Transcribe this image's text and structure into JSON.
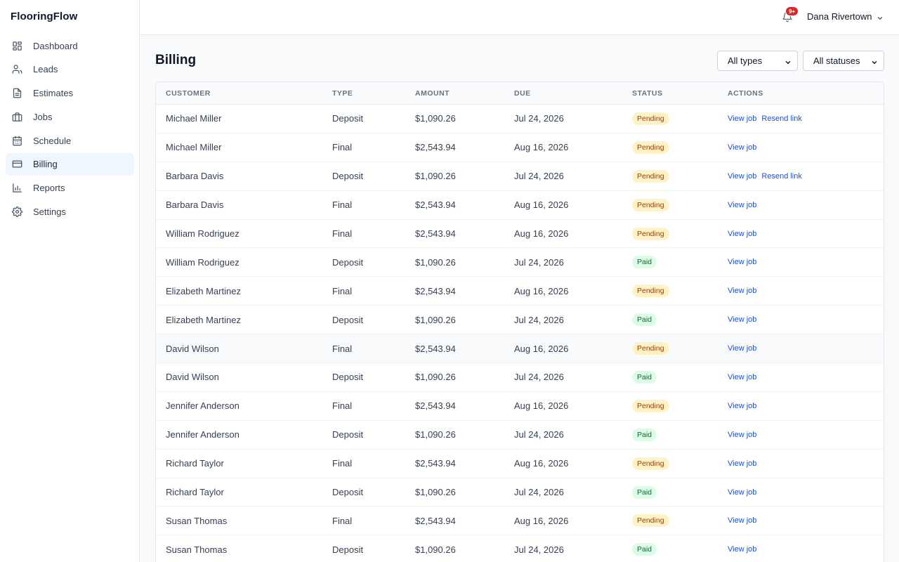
{
  "app": {
    "name": "FlooringFlow"
  },
  "sidebar": {
    "items": [
      {
        "label": "Dashboard",
        "icon": "dashboard-icon"
      },
      {
        "label": "Leads",
        "icon": "users-icon"
      },
      {
        "label": "Estimates",
        "icon": "document-icon"
      },
      {
        "label": "Jobs",
        "icon": "briefcase-icon"
      },
      {
        "label": "Schedule",
        "icon": "calendar-icon"
      },
      {
        "label": "Billing",
        "icon": "credit-card-icon",
        "active": true
      },
      {
        "label": "Reports",
        "icon": "bar-chart-icon"
      },
      {
        "label": "Settings",
        "icon": "gear-icon"
      }
    ]
  },
  "header": {
    "notifications_badge": "9+",
    "user_name": "Dana Rivertown"
  },
  "main": {
    "title": "Billing",
    "filters": {
      "type_selected": "All types",
      "status_selected": "All statuses"
    }
  },
  "table": {
    "columns": [
      "Customer",
      "Type",
      "Amount",
      "Due",
      "Status",
      "Actions"
    ],
    "rows": [
      {
        "customer": "Michael Miller",
        "type": "Deposit",
        "amount": "$1,090.26",
        "due": "Jul 24, 2026",
        "status": "Pending",
        "actions": [
          "View job",
          "Resend link"
        ]
      },
      {
        "customer": "Michael Miller",
        "type": "Final",
        "amount": "$2,543.94",
        "due": "Aug 16, 2026",
        "status": "Pending",
        "actions": [
          "View job"
        ]
      },
      {
        "customer": "Barbara Davis",
        "type": "Deposit",
        "amount": "$1,090.26",
        "due": "Jul 24, 2026",
        "status": "Pending",
        "actions": [
          "View job",
          "Resend link"
        ]
      },
      {
        "customer": "Barbara Davis",
        "type": "Final",
        "amount": "$2,543.94",
        "due": "Aug 16, 2026",
        "status": "Pending",
        "actions": [
          "View job"
        ]
      },
      {
        "customer": "William Rodriguez",
        "type": "Final",
        "amount": "$2,543.94",
        "due": "Aug 16, 2026",
        "status": "Pending",
        "actions": [
          "View job"
        ]
      },
      {
        "customer": "William Rodriguez",
        "type": "Deposit",
        "amount": "$1,090.26",
        "due": "Jul 24, 2026",
        "status": "Paid",
        "actions": [
          "View job"
        ]
      },
      {
        "customer": "Elizabeth Martinez",
        "type": "Final",
        "amount": "$2,543.94",
        "due": "Aug 16, 2026",
        "status": "Pending",
        "actions": [
          "View job"
        ]
      },
      {
        "customer": "Elizabeth Martinez",
        "type": "Deposit",
        "amount": "$1,090.26",
        "due": "Jul 24, 2026",
        "status": "Paid",
        "actions": [
          "View job"
        ]
      },
      {
        "customer": "David Wilson",
        "type": "Final",
        "amount": "$2,543.94",
        "due": "Aug 16, 2026",
        "status": "Pending",
        "actions": [
          "View job"
        ]
      },
      {
        "customer": "David Wilson",
        "type": "Deposit",
        "amount": "$1,090.26",
        "due": "Jul 24, 2026",
        "status": "Paid",
        "actions": [
          "View job"
        ]
      },
      {
        "customer": "Jennifer Anderson",
        "type": "Final",
        "amount": "$2,543.94",
        "due": "Aug 16, 2026",
        "status": "Pending",
        "actions": [
          "View job"
        ]
      },
      {
        "customer": "Jennifer Anderson",
        "type": "Deposit",
        "amount": "$1,090.26",
        "due": "Jul 24, 2026",
        "status": "Paid",
        "actions": [
          "View job"
        ]
      },
      {
        "customer": "Richard Taylor",
        "type": "Final",
        "amount": "$2,543.94",
        "due": "Aug 16, 2026",
        "status": "Pending",
        "actions": [
          "View job"
        ]
      },
      {
        "customer": "Richard Taylor",
        "type": "Deposit",
        "amount": "$1,090.26",
        "due": "Jul 24, 2026",
        "status": "Paid",
        "actions": [
          "View job"
        ]
      },
      {
        "customer": "Susan Thomas",
        "type": "Final",
        "amount": "$2,543.94",
        "due": "Aug 16, 2026",
        "status": "Pending",
        "actions": [
          "View job"
        ]
      },
      {
        "customer": "Susan Thomas",
        "type": "Deposit",
        "amount": "$1,090.26",
        "due": "Jul 24, 2026",
        "status": "Paid",
        "actions": [
          "View job"
        ]
      }
    ]
  },
  "colors": {
    "accent": "#1d4ed8",
    "pending_bg": "#fef3c7",
    "pending_text": "#92400e",
    "paid_bg": "#dcfce7",
    "paid_text": "#166534",
    "notification": "#dc2626"
  }
}
